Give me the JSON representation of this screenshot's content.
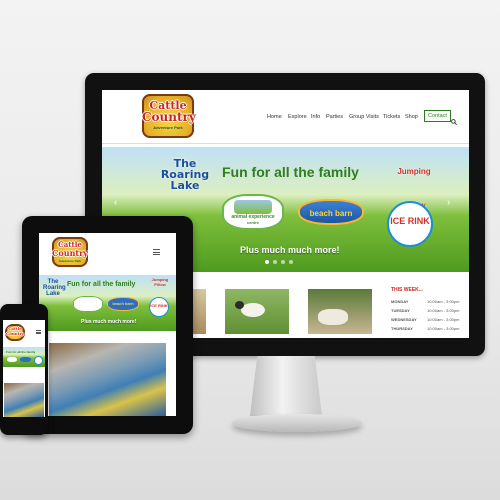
{
  "site": {
    "logo_line1": "Cattle",
    "logo_line2": "Country",
    "logo_line3": "Adventure Park"
  },
  "nav": {
    "items": [
      "Home",
      "Explore",
      "Info",
      "Parties",
      "Group Visits",
      "Tickets",
      "Shop"
    ],
    "contact_label": "Contact",
    "search_icon": "search-icon"
  },
  "hero": {
    "tagline": "Fun for all the family",
    "subline": "Plus much much more!",
    "badges": {
      "roaring_lake": "The Roaring Lake",
      "jumping_pillow": "Jumping Pillow",
      "animal_experience": "animal experience",
      "animal_experience_sub": "centre",
      "beach_barn": "beach barn",
      "ice_rink": "ICE RINK"
    },
    "slider_prev": "‹",
    "slider_next": "›"
  },
  "schedule": {
    "heading": "THIS WEEK...",
    "rows": [
      {
        "day": "MONDAY",
        "hours": "10:00am - 3:00pm"
      },
      {
        "day": "TUESDAY",
        "hours": "10:00am - 3:00pm"
      },
      {
        "day": "WEDNESDAY",
        "hours": "10:00am - 3:00pm"
      },
      {
        "day": "THURSDAY",
        "hours": "10:00am - 3:00pm"
      }
    ]
  },
  "colors": {
    "brand_green": "#2a7b1e",
    "accent_red": "#c8261f",
    "monitor_bezel": "#111111"
  }
}
